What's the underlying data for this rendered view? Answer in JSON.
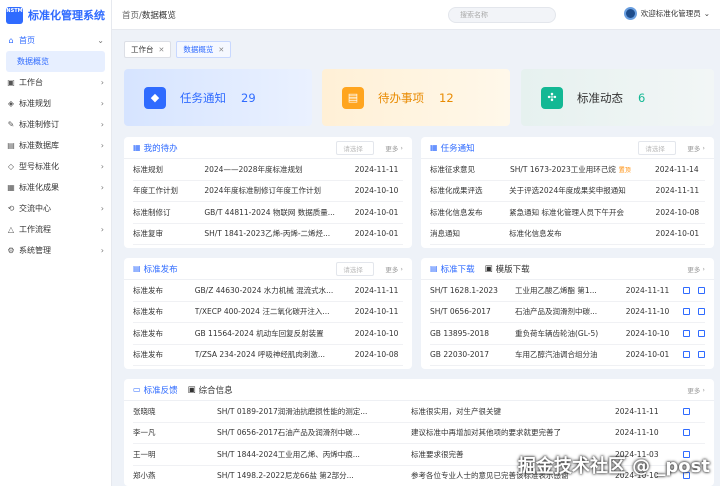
{
  "app": {
    "logo_text": "NSTM",
    "title": "标准化管理系统"
  },
  "sidebar": {
    "items": [
      {
        "label": "首页",
        "icon": "home-icon",
        "glyph": "⌂",
        "expanded": true
      },
      {
        "label": "工作台",
        "icon": "workbench-icon",
        "glyph": "▣"
      },
      {
        "label": "标准规划",
        "icon": "plan-icon",
        "glyph": "◈"
      },
      {
        "label": "标准制修订",
        "icon": "revise-icon",
        "glyph": "✎"
      },
      {
        "label": "标准数据库",
        "icon": "database-icon",
        "glyph": "▤"
      },
      {
        "label": "型号标准化",
        "icon": "model-icon",
        "glyph": "◇"
      },
      {
        "label": "标准化成果",
        "icon": "result-icon",
        "glyph": "▦"
      },
      {
        "label": "交流中心",
        "icon": "exchange-icon",
        "glyph": "⟲"
      },
      {
        "label": "工作流程",
        "icon": "workflow-icon",
        "glyph": "△"
      },
      {
        "label": "系统管理",
        "icon": "settings-icon",
        "glyph": "⚙"
      }
    ],
    "sub_item": "数据概览"
  },
  "header": {
    "breadcrumb_root": "首页",
    "breadcrumb_sep": "/",
    "breadcrumb_current": "数据概览",
    "search_placeholder": "搜索名称",
    "user_greeting": "欢迎标准化管理员"
  },
  "tabs": [
    {
      "label": "工作台",
      "active": false
    },
    {
      "label": "数据概览",
      "active": true
    }
  ],
  "stats": [
    {
      "label": "任务通知",
      "value": "29",
      "icon": "bell-icon",
      "glyph": "🔔",
      "color": "#2f6bff"
    },
    {
      "label": "待办事项",
      "value": "12",
      "icon": "todo-icon",
      "glyph": "▤",
      "color": "#ffa51f"
    },
    {
      "label": "标准动态",
      "value": "6",
      "icon": "pinwheel-icon",
      "glyph": "✣",
      "color": "#13b894"
    }
  ],
  "panels": {
    "todo": {
      "title": "我的待办",
      "select": "请选择",
      "more": "更多",
      "rows": [
        [
          "标准规划",
          "2024——2028年度标准规划",
          "2024-11-11"
        ],
        [
          "年度工作计划",
          "2024年度标准制修订年度工作计划",
          "2024-10-10"
        ],
        [
          "标准制修订",
          "GB/T 44811-2024 物联网 数据质量...",
          "2024-10-01"
        ],
        [
          "标准复审",
          "SH/T 1841-2023乙烯-丙烯-二烯烃...",
          "2024-10-01"
        ]
      ]
    },
    "task": {
      "title": "任务通知",
      "select": "请选择",
      "more": "更多",
      "badge": "置顶",
      "rows": [
        [
          "标准征求意见",
          "SH/T 1673-2023工业用环己烷",
          "2024-11-14"
        ],
        [
          "标准化成果评选",
          "关于评选2024年度成果奖申报通知",
          "2024-11-11"
        ],
        [
          "标准化信息发布",
          "紧急通知 标准化管理人员下午开会",
          "2024-10-08"
        ],
        [
          "消息通知",
          "标准化信息发布",
          "2024-10-01"
        ]
      ]
    },
    "publish": {
      "title": "标准发布",
      "select": "请选择",
      "more": "更多",
      "rows": [
        [
          "标准发布",
          "GB/Z 44630-2024 水力机械 混流式水...",
          "2024-11-11"
        ],
        [
          "标准发布",
          "T/XECP 400-2024 汪二氧化碳开注入...",
          "2024-10-11"
        ],
        [
          "标准发布",
          "GB 11564-2024 机动车回复反射装置",
          "2024-10-10"
        ],
        [
          "标准发布",
          "T/ZSA 234-2024 呼吸神经肌肉刺激...",
          "2024-10-08"
        ]
      ]
    },
    "download": {
      "title": "标准下载",
      "title2": "模版下载",
      "more": "更多",
      "rows": [
        [
          "SH/T 1628.1-2023",
          "工业用乙酸乙烯酯 第1...",
          "2024-11-11"
        ],
        [
          "SH/T 0656-2017",
          "石油产品及润滑剂中碳...",
          "2024-11-10"
        ],
        [
          "GB 13895-2018",
          "重负荷车辆齿轮油(GL-5)",
          "2024-10-10"
        ],
        [
          "GB 22030-2017",
          "车用乙醇汽油调合组分油",
          "2024-10-01"
        ]
      ]
    },
    "feedback": {
      "title": "标准反馈",
      "title2": "综合信息",
      "more": "更多",
      "rows": [
        [
          "张晓晓",
          "SH/T 0189-2017润滑油抗磨损性能的测定...",
          "标准很实用，对生产很关键",
          "2024-11-11"
        ],
        [
          "李一凡",
          "SH/T 0656-2017石油产品及润滑剂中碳...",
          "建议标准中再增加对其他项的要求就更完善了",
          "2024-11-10"
        ],
        [
          "王一明",
          "SH/T 1844-2024工业用乙烯、丙烯中痕...",
          "标准要求很完善",
          "2024-11-03"
        ],
        [
          "郑小燕",
          "SH/T 1498.2-2022尼龙66盐 第2部分...",
          "参考各位专业人士的意见已完善该标准表示感谢",
          "2024-10-10"
        ]
      ]
    }
  },
  "watermark": "掘金技术社区 @ _post"
}
